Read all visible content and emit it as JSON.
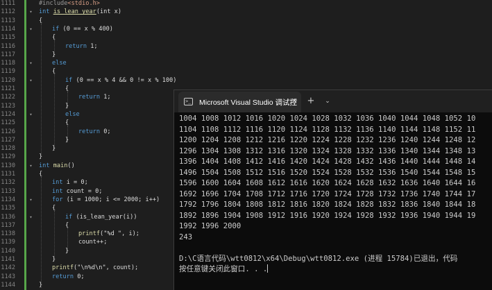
{
  "editor": {
    "line_numbers": [
      "1111",
      "1112",
      "1113",
      "1114",
      "1115",
      "1116",
      "1117",
      "1118",
      "1119",
      "1120",
      "1121",
      "1122",
      "1123",
      "1124",
      "1125",
      "1126",
      "1127",
      "1128",
      "1129",
      "1130",
      "1131",
      "1132",
      "1133",
      "1134",
      "1135",
      "1136",
      "1137",
      "1138",
      "1139",
      "1140",
      "1141",
      "1142",
      "1143",
      "1144"
    ],
    "code": {
      "include_directive": "#include",
      "include_file": "<stdio.h>",
      "kw_int": "int",
      "fn_is_leap": "is_lean_year",
      "param": "(int x)",
      "brace_open": "{",
      "brace_close": "}",
      "kw_if": "if",
      "cond1": " (0 == x % 400)",
      "kw_return": "return",
      "ret1": " 1;",
      "ret0": " 0;",
      "kw_else": "else",
      "cond2": " (0 == x % 4 && 0 != x % 100)",
      "fn_main": "main",
      "main_paren": "()",
      "decl_i": " i = 0;",
      "decl_count": " count = 0;",
      "kw_for": "for",
      "for_head": " (i = 1000; i <= 2000; i++)",
      "if_call": " (is_lean_year(i))",
      "fn_printf": "printf",
      "printf1_args": "(\"%d \", i);",
      "count_inc": "count++;",
      "printf2_args": "(\"\\n%d\\n\", count);",
      "ret_main": " 0;"
    }
  },
  "console": {
    "tab_title": "Microsoft Visual Studio 调试控",
    "tab_icon_glyph": ">_",
    "close_glyph": "✕",
    "new_tab_glyph": "+",
    "dropdown_glyph": "⌄",
    "output_lines": [
      "1004 1008 1012 1016 1020 1024 1028 1032 1036 1040 1044 1048 1052 10",
      "1104 1108 1112 1116 1120 1124 1128 1132 1136 1140 1144 1148 1152 11",
      "1200 1204 1208 1212 1216 1220 1224 1228 1232 1236 1240 1244 1248 12",
      "1296 1304 1308 1312 1316 1320 1324 1328 1332 1336 1340 1344 1348 13",
      "1396 1404 1408 1412 1416 1420 1424 1428 1432 1436 1440 1444 1448 14",
      "1496 1504 1508 1512 1516 1520 1524 1528 1532 1536 1540 1544 1548 15",
      "1596 1600 1604 1608 1612 1616 1620 1624 1628 1632 1636 1640 1644 16",
      "1692 1696 1704 1708 1712 1716 1720 1724 1728 1732 1736 1740 1744 17",
      "1792 1796 1804 1808 1812 1816 1820 1824 1828 1832 1836 1840 1844 18",
      "1892 1896 1904 1908 1912 1916 1920 1924 1928 1932 1936 1940 1944 19",
      "1992 1996 2000",
      "243",
      "",
      "D:\\C语言代码\\wtt0812\\x64\\Debug\\wtt0812.exe (进程 15784)已退出，代码",
      "按任意键关闭此窗口. . ."
    ]
  }
}
